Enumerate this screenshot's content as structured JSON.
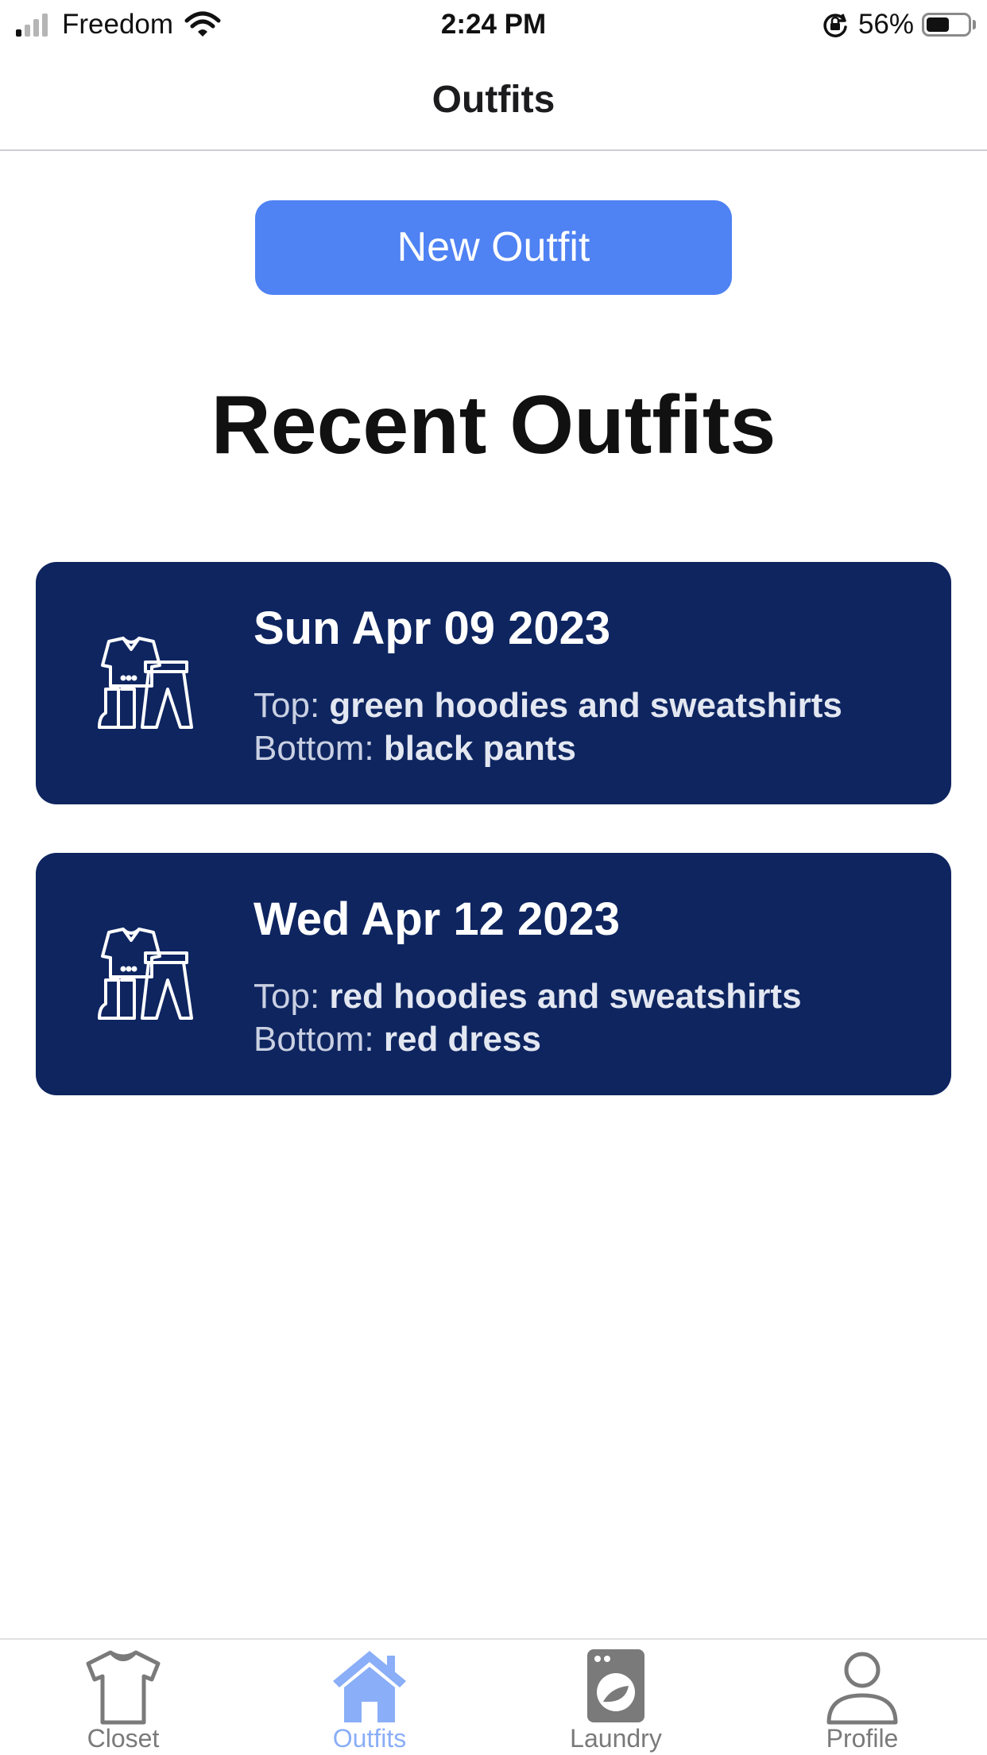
{
  "status_bar": {
    "carrier": "Freedom",
    "time": "2:24 PM",
    "battery_percent": "56%",
    "battery_level": 0.56,
    "signal_bars_active": 1,
    "signal_bars_total": 4,
    "icons": [
      "signal-icon",
      "wifi-icon",
      "orientation-lock-icon",
      "battery-icon"
    ]
  },
  "nav": {
    "title": "Outfits"
  },
  "actions": {
    "new_outfit_label": "New Outfit"
  },
  "section": {
    "title": "Recent Outfits"
  },
  "outfits": [
    {
      "icon": "clothes-icon",
      "date": "Sun Apr 09 2023",
      "top_label": "Top:",
      "top_value": "green hoodies and sweatshirts",
      "bottom_label": "Bottom:",
      "bottom_value": "black pants"
    },
    {
      "icon": "clothes-icon",
      "date": "Wed Apr 12 2023",
      "top_label": "Top:",
      "top_value": "red hoodies and sweatshirts",
      "bottom_label": "Bottom:",
      "bottom_value": "red dress"
    }
  ],
  "tabs": [
    {
      "label": "Closet",
      "icon": "tshirt-icon",
      "active": false
    },
    {
      "label": "Outfits",
      "icon": "home-icon",
      "active": true
    },
    {
      "label": "Laundry",
      "icon": "washing-machine-icon",
      "active": false
    },
    {
      "label": "Profile",
      "icon": "person-icon",
      "active": false
    }
  ],
  "colors": {
    "primary_button": "#4f82f3",
    "card_background": "#0e2560",
    "active_tab": "#8aaef7",
    "inactive_tab": "#7a7a7a"
  }
}
